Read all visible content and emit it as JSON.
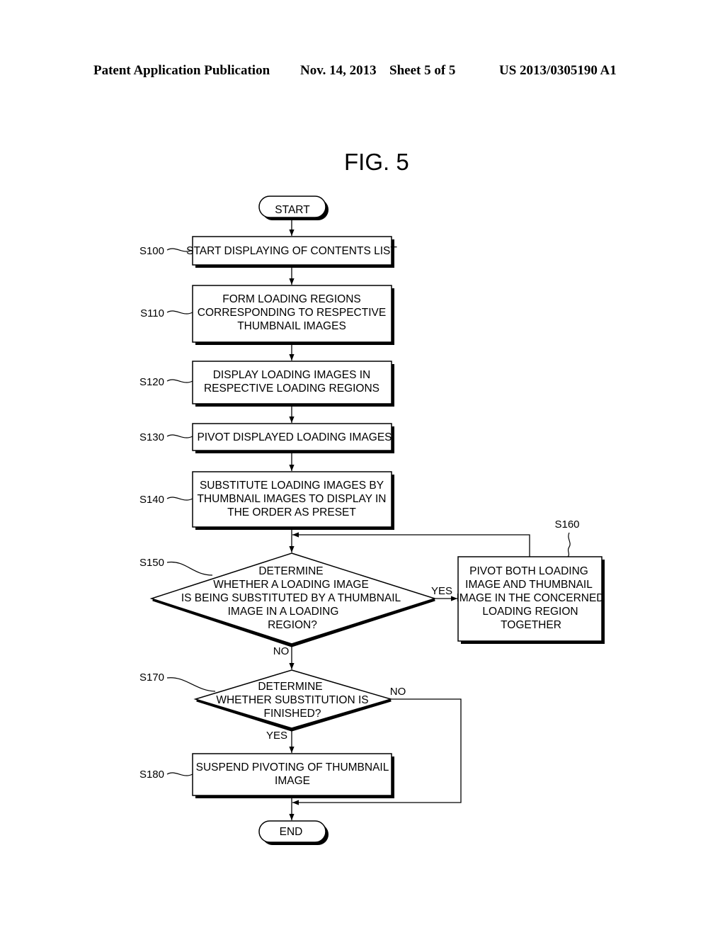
{
  "header": {
    "publication": "Patent Application Publication",
    "date": "Nov. 14, 2013",
    "sheet": "Sheet 5 of 5",
    "number": "US 2013/0305190 A1"
  },
  "figure": {
    "title": "FIG. 5"
  },
  "nodes": {
    "start": {
      "lines": [
        "START"
      ]
    },
    "s100": {
      "ref": "S100",
      "lines": [
        "START DISPLAYING OF CONTENTS LIST"
      ]
    },
    "s110": {
      "ref": "S110",
      "lines": [
        "FORM LOADING REGIONS",
        "CORRESPONDING TO RESPECTIVE",
        "THUMBNAIL IMAGES"
      ]
    },
    "s120": {
      "ref": "S120",
      "lines": [
        "DISPLAY LOADING IMAGES IN",
        "RESPECTIVE LOADING REGIONS"
      ]
    },
    "s130": {
      "ref": "S130",
      "lines": [
        "PIVOT DISPLAYED LOADING IMAGES"
      ]
    },
    "s140": {
      "ref": "S140",
      "lines": [
        "SUBSTITUTE LOADING IMAGES BY",
        "THUMBNAIL IMAGES TO DISPLAY IN",
        "THE ORDER AS PRESET"
      ]
    },
    "s150": {
      "ref": "S150",
      "lines": [
        "DETERMINE",
        "WHETHER A LOADING IMAGE",
        "IS BEING SUBSTITUTED BY A THUMBNAIL",
        "IMAGE IN A LOADING",
        "REGION?"
      ]
    },
    "s160": {
      "ref": "S160",
      "lines": [
        "PIVOT BOTH LOADING",
        "IMAGE AND THUMBNAIL",
        "IMAGE IN THE CONCERNED",
        "LOADING REGION",
        "TOGETHER"
      ]
    },
    "s170": {
      "ref": "S170",
      "lines": [
        "DETERMINE",
        "WHETHER SUBSTITUTION IS",
        "FINISHED?"
      ]
    },
    "s180": {
      "ref": "S180",
      "lines": [
        "SUSPEND PIVOTING OF THUMBNAIL",
        "IMAGE"
      ]
    },
    "end": {
      "lines": [
        "END"
      ]
    }
  },
  "edge_labels": {
    "s150_yes": "YES",
    "s150_no": "NO",
    "s170_yes": "YES",
    "s170_no": "NO"
  }
}
